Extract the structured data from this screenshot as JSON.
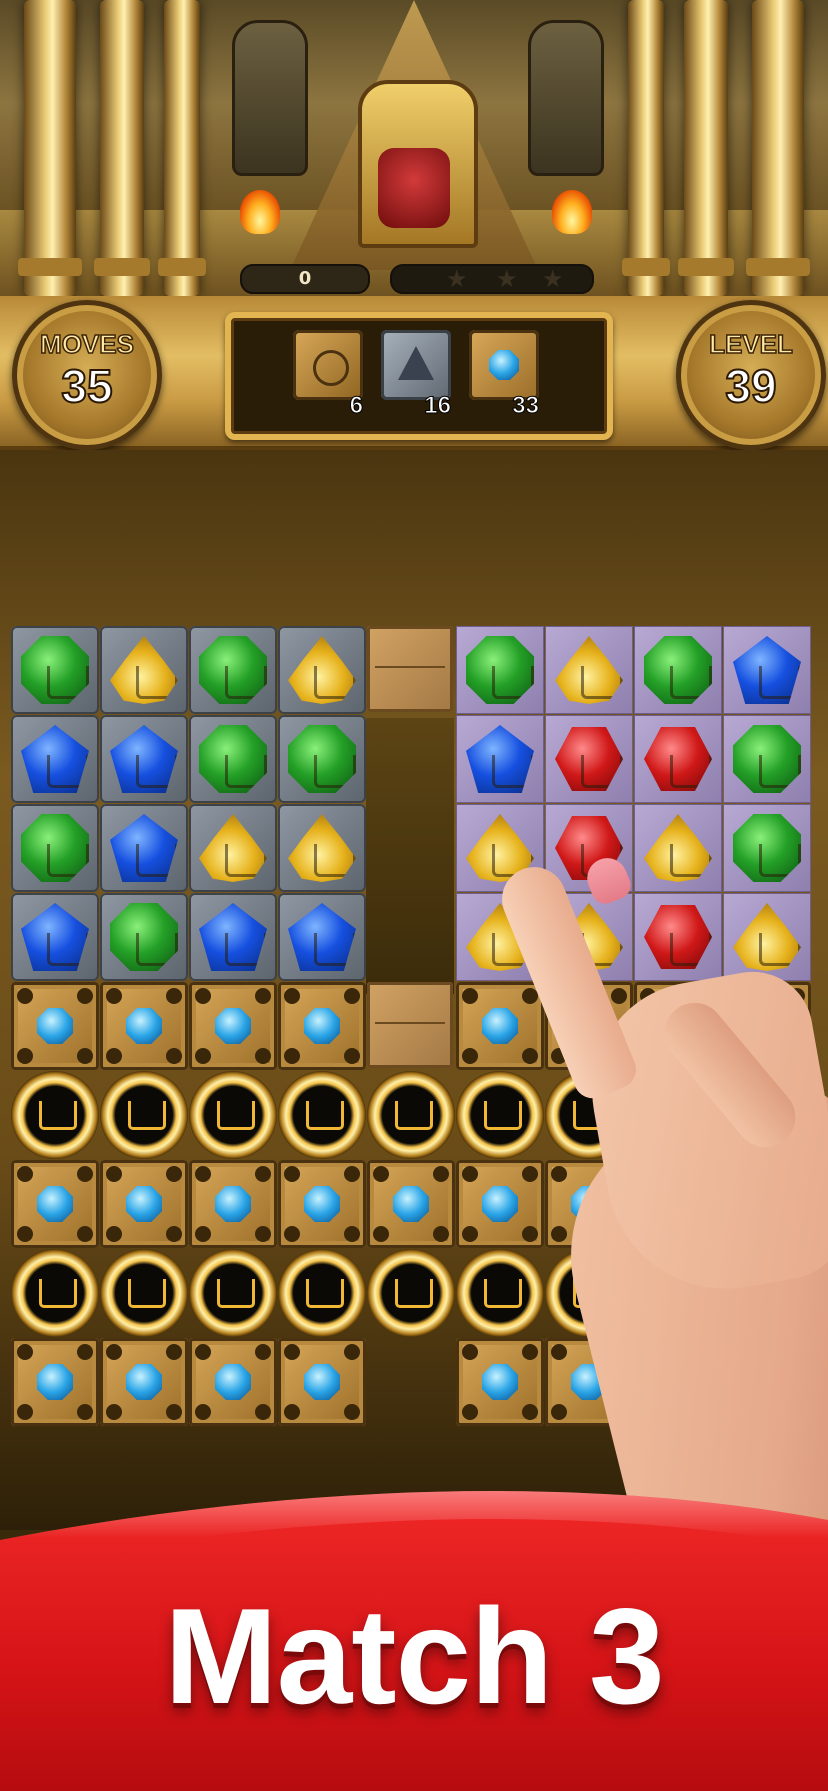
{
  "scene": {
    "score": "0"
  },
  "hud": {
    "moves": {
      "label": "MOVES",
      "value": "35"
    },
    "level": {
      "label": "LEVEL",
      "value": "39"
    },
    "goals": [
      {
        "name": "sun-tile",
        "count": "6"
      },
      {
        "name": "stone-triangle-tile",
        "count": "16"
      },
      {
        "name": "blue-gem-box",
        "count": "33"
      }
    ]
  },
  "banner": {
    "title": "Match 3"
  },
  "colors": {
    "banner_red": "#e01a1c",
    "gold": "#e2b550"
  }
}
